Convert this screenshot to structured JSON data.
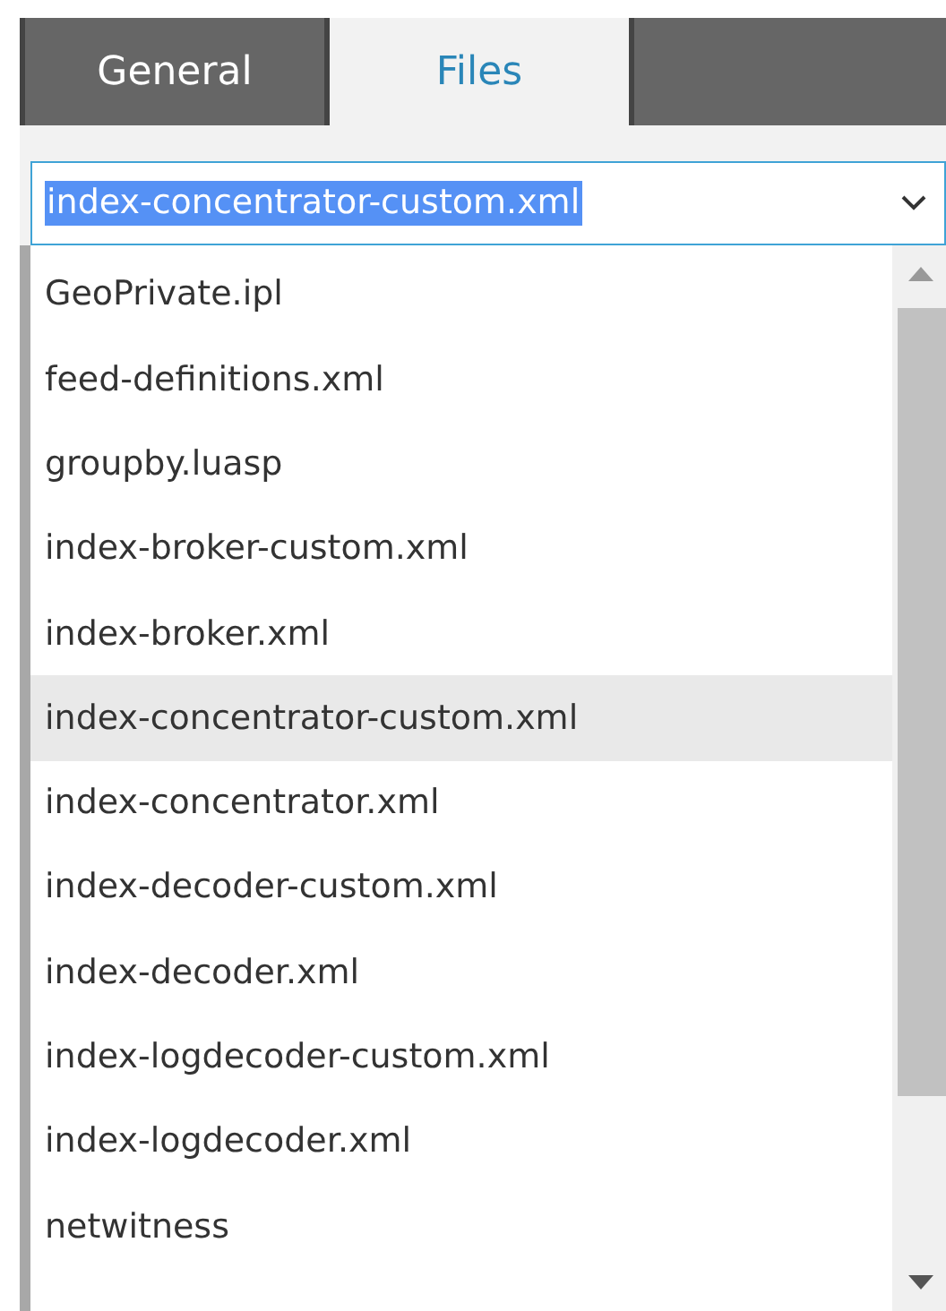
{
  "tabs": [
    {
      "label": "General",
      "selected": false
    },
    {
      "label": "Files",
      "selected": true
    }
  ],
  "file_select": {
    "value": "index-concentrator-custom.xml",
    "text_selected": true
  },
  "options": [
    {
      "label": "GeoPrivate.ipl",
      "selected": false
    },
    {
      "label": "feed-definitions.xml",
      "selected": false
    },
    {
      "label": "groupby.luasp",
      "selected": false
    },
    {
      "label": "index-broker-custom.xml",
      "selected": false
    },
    {
      "label": "index-broker.xml",
      "selected": false
    },
    {
      "label": "index-concentrator-custom.xml",
      "selected": true
    },
    {
      "label": "index-concentrator.xml",
      "selected": false
    },
    {
      "label": "index-decoder-custom.xml",
      "selected": false
    },
    {
      "label": "index-decoder.xml",
      "selected": false
    },
    {
      "label": "index-logdecoder-custom.xml",
      "selected": false
    },
    {
      "label": "index-logdecoder.xml",
      "selected": false
    },
    {
      "label": "netwitness",
      "selected": false
    }
  ]
}
